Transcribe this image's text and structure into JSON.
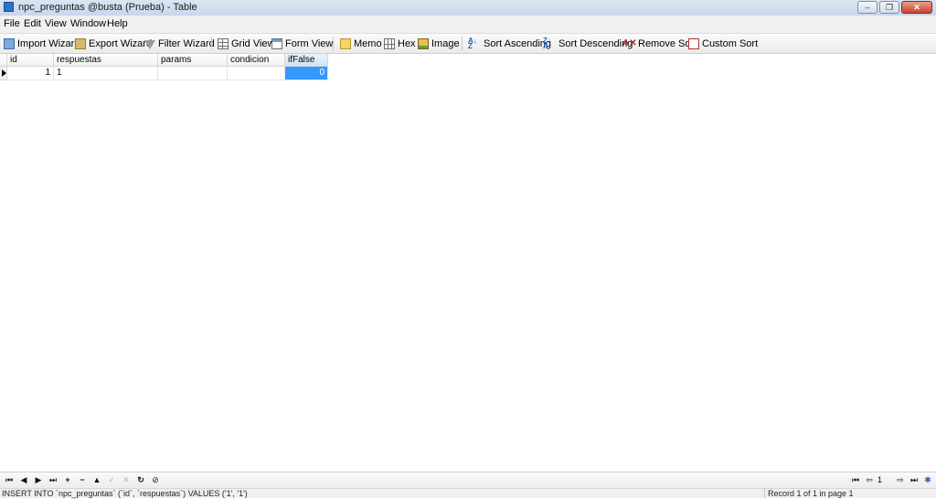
{
  "window": {
    "title": "npc_preguntas @busta (Prueba) - Table",
    "minimize_label": "–",
    "restore_label": "❐",
    "close_label": "✕"
  },
  "menu": [
    "File",
    "Edit",
    "View",
    "Window",
    "Help"
  ],
  "toolbar": {
    "import_wizard": "Import Wizard",
    "export_wizard": "Export Wizard",
    "filter_wizard": "Filter Wizard",
    "grid_view": "Grid View",
    "form_view": "Form View",
    "memo": "Memo",
    "hex": "Hex",
    "image": "Image",
    "sort_ascending": "Sort Ascending",
    "sort_descending": "Sort Descending",
    "remove_sort": "Remove Sort",
    "custom_sort": "Custom Sort"
  },
  "grid": {
    "columns": [
      "id",
      "respuestas",
      "params",
      "condicion",
      "ifFalse"
    ],
    "active_column": "ifFalse",
    "rows": [
      {
        "id": "1",
        "respuestas": "1",
        "params": "",
        "condicion": "",
        "ifFalse": "0"
      }
    ]
  },
  "navigation": {
    "current_page": "1"
  },
  "status": {
    "sql": "INSERT INTO `npc_preguntas` (`id`, `respuestas`) VALUES ('1', '1')",
    "record_info": "Record 1 of 1 in page 1"
  },
  "colors": {
    "selection": "#3399ff",
    "active_header": "#cfe5f8"
  }
}
